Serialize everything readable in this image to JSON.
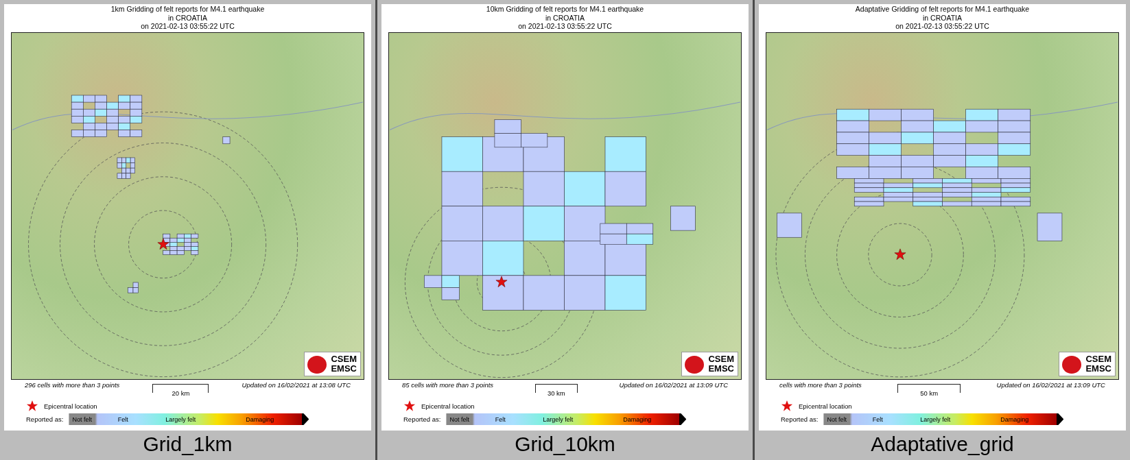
{
  "panels": [
    {
      "title": "1km Gridding of felt reports for M4.1 earthquake\nin CROATIA\non  2021-02-13 03:55:22 UTC",
      "cells_note": "296 cells with more than 3 points",
      "scale": "20 km",
      "updated": "Updated on 16/02/2021 at 13:08 UTC",
      "epicenter": "Epicentral location",
      "reported_as": "Reported as:",
      "scale_labels": [
        "Not felt",
        "Felt",
        "Largely felt",
        "Damaging"
      ],
      "logo": [
        "CSEM",
        "EMSC"
      ],
      "caption": "Grid_1km"
    },
    {
      "title": "10km Gridding of felt reports for M4.1 earthquake\nin CROATIA\non  2021-02-13 03:55:22 UTC",
      "cells_note": "85 cells with more than 3 points",
      "scale": "30 km",
      "updated": "Updated on 16/02/2021 at 13:09 UTC",
      "epicenter": "Epicentral location",
      "reported_as": "Reported as:",
      "scale_labels": [
        "Not felt",
        "Felt",
        "Largely felt",
        "Damaging"
      ],
      "logo": [
        "CSEM",
        "EMSC"
      ],
      "caption": "Grid_10km"
    },
    {
      "title": "Adaptative Gridding of felt reports for M4.1 earthquake\nin CROATIA\non  2021-02-13 03:55:22 UTC",
      "cells_note": "cells with more than 3 points",
      "scale": "50 km",
      "updated": "Updated on 16/02/2021 at 13:09 UTC",
      "epicenter": "Epicentral location",
      "reported_as": "Reported as:",
      "scale_labels": [
        "Not felt",
        "Felt",
        "Largely felt",
        "Damaging"
      ],
      "logo": [
        "CSEM",
        "EMSC"
      ],
      "caption": "Adaptative_grid"
    }
  ]
}
